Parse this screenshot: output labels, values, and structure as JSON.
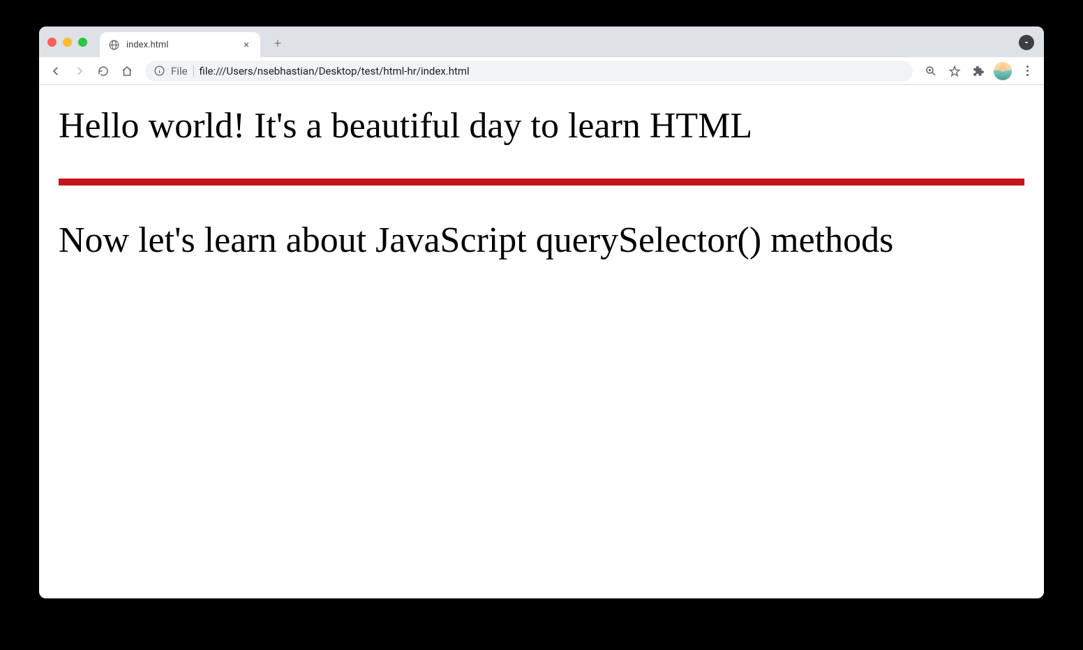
{
  "browser": {
    "tab": {
      "title": "index.html"
    },
    "address": {
      "scheme": "File",
      "url": "file:///Users/nsebhastian/Desktop/test/html-hr/index.html"
    }
  },
  "content": {
    "heading1": "Hello world! It's a beautiful day to learn HTML",
    "heading2": "Now let's learn about JavaScript querySelector() methods",
    "hr_color": "#c5151f"
  }
}
